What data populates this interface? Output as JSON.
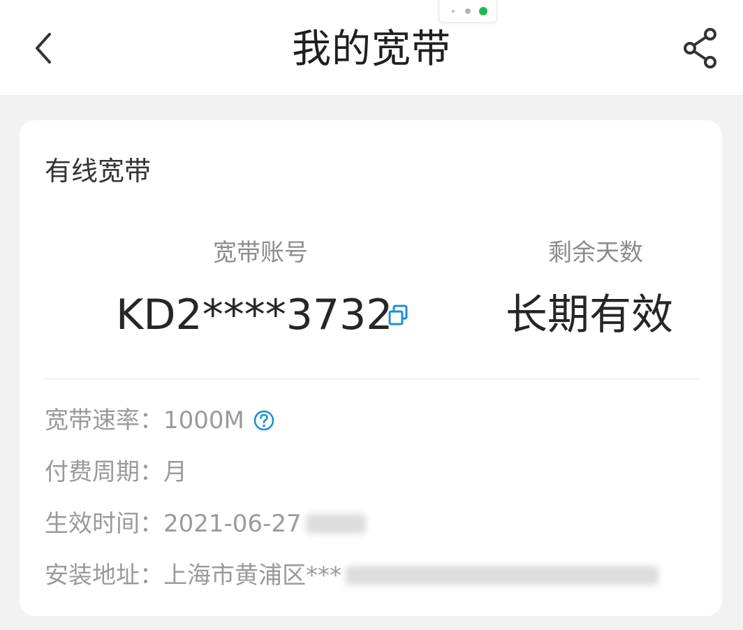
{
  "header": {
    "title": "我的宽带",
    "back_icon": "chevron-left-icon",
    "share_icon": "share-icon"
  },
  "card": {
    "title": "有线宽带",
    "account_label": "宽带账号",
    "account_value": "KD2****3732",
    "remaining_label": "剩余天数",
    "remaining_value": "长期有效",
    "copy_icon": "copy-icon",
    "rows": [
      {
        "label": "宽带速率：",
        "value": "1000M"
      },
      {
        "label": "付费周期：",
        "value": "月"
      },
      {
        "label": "生效时间：",
        "value": "2021-06-27"
      },
      {
        "label": "安装地址：",
        "value": "上海市黄浦区***"
      }
    ],
    "help_icon": "help-circle-icon"
  },
  "colors": {
    "accent": "#1a8fd8",
    "capsule_dot": "#1db954",
    "background": "#f2f2f2"
  }
}
